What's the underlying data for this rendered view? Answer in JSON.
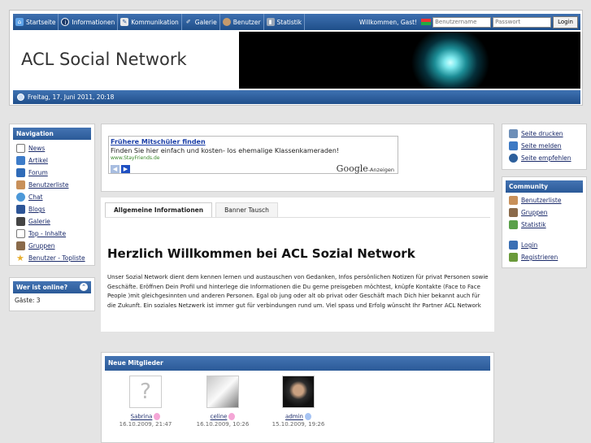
{
  "nav": {
    "items": [
      {
        "label": "Startseite",
        "icon": "home-icon"
      },
      {
        "label": "Informationen",
        "icon": "info-icon"
      },
      {
        "label": "Kommunikation",
        "icon": "message-icon"
      },
      {
        "label": "Galerie",
        "icon": "pencil-icon"
      },
      {
        "label": "Benutzer",
        "icon": "user-icon"
      },
      {
        "label": "Statistik",
        "icon": "stats-icon"
      }
    ],
    "welcome": "Willkommen, Gast!",
    "username_placeholder": "Benutzername",
    "password_placeholder": "Passwort",
    "login_label": "Login"
  },
  "banner": {
    "title": "ACL Social Network"
  },
  "datebar": {
    "date": "Freitag, 17. Juni 2011, 20:18"
  },
  "sidebar": {
    "title": "Navigation",
    "items": [
      {
        "label": "News",
        "icon": "page-icon"
      },
      {
        "label": "Artikel",
        "icon": "article-icon"
      },
      {
        "label": "Forum",
        "icon": "forum-icon"
      },
      {
        "label": "Benutzerliste",
        "icon": "userlist-icon"
      },
      {
        "label": "Chat",
        "icon": "chat-icon"
      },
      {
        "label": "Blogs",
        "icon": "blog-icon"
      },
      {
        "label": "Galerie",
        "icon": "gallery-icon"
      },
      {
        "label": "Top - Inhalte",
        "icon": "top-icon"
      },
      {
        "label": "Gruppen",
        "icon": "group-icon"
      },
      {
        "label": "Benutzer - Topliste",
        "icon": "star-icon"
      }
    ]
  },
  "online": {
    "title": "Wer ist online?",
    "guests": "Gäste: 3"
  },
  "ad": {
    "title": "Frühere Mitschüler finden",
    "text": "Finden Sie hier einfach und kosten- los ehemalige Klassenkameraden!",
    "url": "www.StayFriends.de",
    "brand": "Google",
    "brand_suffix": "-Anzeigen"
  },
  "tabs": [
    {
      "label": "Allgemeine Informationen",
      "active": true
    },
    {
      "label": "Banner Tausch",
      "active": false
    }
  ],
  "main": {
    "title": "Herzlich Willkommen bei ACL Sozial Network",
    "text": "Unser Sozial Network dient dem kennen lernen und austauschen von Gedanken, Infos persönlichen Notizen für privat Personen sowie Geschäfte. Eröffnen Dein Profil und hinterlege die Informationen die Du gerne preisgeben möchtest, knüpfe Kontakte (Face to Face People )mit gleichgesinnten und anderen Personen. Egal ob jung oder alt ob privat oder Geschäft mach Dich hier bekannt auch für die Zukunft. Ein soziales Netzwerk ist immer gut für verbindungen rund um. Viel spass und Erfolg wünscht Ihr Partner ACL Network"
  },
  "new_members": {
    "title": "Neue Mitglieder",
    "members": [
      {
        "name": "Sabrina",
        "date": "16.10.2009, 21:47",
        "gender": "female"
      },
      {
        "name": "celine",
        "date": "16.10.2009, 10:26",
        "gender": "female"
      },
      {
        "name": "admin",
        "date": "15.10.2009, 19:26",
        "gender": "male"
      }
    ]
  },
  "tools": {
    "items": [
      {
        "label": "Seite drucken",
        "icon": "print-icon"
      },
      {
        "label": "Seite melden",
        "icon": "report-icon"
      },
      {
        "label": "Seite empfehlen",
        "icon": "recommend-icon"
      }
    ]
  },
  "community": {
    "title": "Community",
    "items": [
      {
        "label": "Benutzerliste",
        "icon": "userlist-icon"
      },
      {
        "label": "Gruppen",
        "icon": "group-icon"
      },
      {
        "label": "Statistik",
        "icon": "stats-icon"
      }
    ],
    "auth": [
      {
        "label": "Login",
        "icon": "login-icon"
      },
      {
        "label": "Registrieren",
        "icon": "register-icon"
      }
    ]
  },
  "colors": {
    "nav_bar": "#2d5e9e",
    "accent": "#4474b3",
    "link": "#1a2a6a",
    "page_bg": "#e4e4e4"
  }
}
